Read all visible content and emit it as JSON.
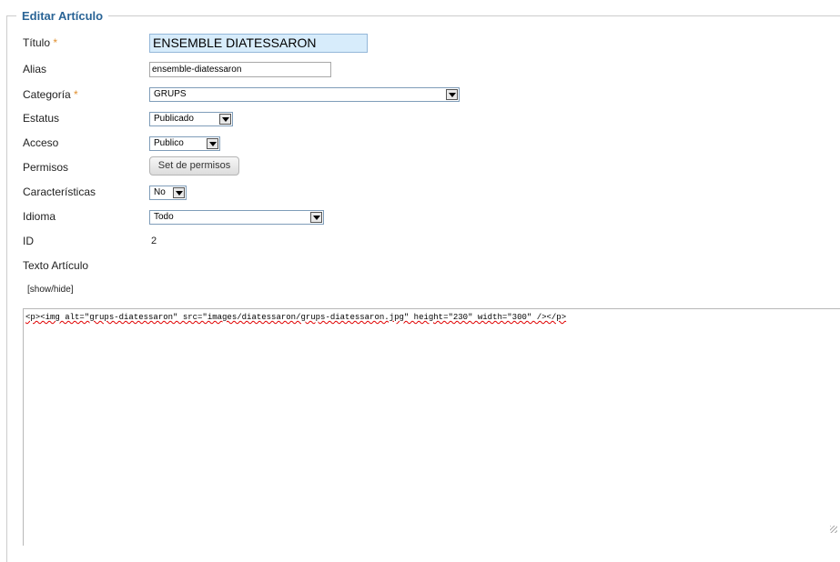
{
  "form": {
    "legend": "Editar Artículo",
    "required_marker": "*",
    "fields": {
      "titulo": {
        "label": "Título",
        "value": "ENSEMBLE DIATESSARON"
      },
      "alias": {
        "label": "Alias",
        "value": "ensemble-diatessaron"
      },
      "categoria": {
        "label": "Categoría",
        "value": "GRUPS"
      },
      "estatus": {
        "label": "Estatus",
        "value": "Publicado"
      },
      "acceso": {
        "label": "Acceso",
        "value": "Publico"
      },
      "permisos": {
        "label": "Permisos",
        "button_label": "Set de permisos"
      },
      "caracteristicas": {
        "label": "Características",
        "value": "No"
      },
      "idioma": {
        "label": "Idioma",
        "value": "Todo"
      },
      "id": {
        "label": "ID",
        "value": "2"
      },
      "texto": {
        "label": "Texto Artículo"
      }
    },
    "toggle_label": "[show/hide]",
    "editor_content": "<p><img alt=\"grups-diatessaron\" src=\"images/diatessaron/grups-diatessaron.jpg\" height=\"230\" width=\"300\" /></p>"
  }
}
